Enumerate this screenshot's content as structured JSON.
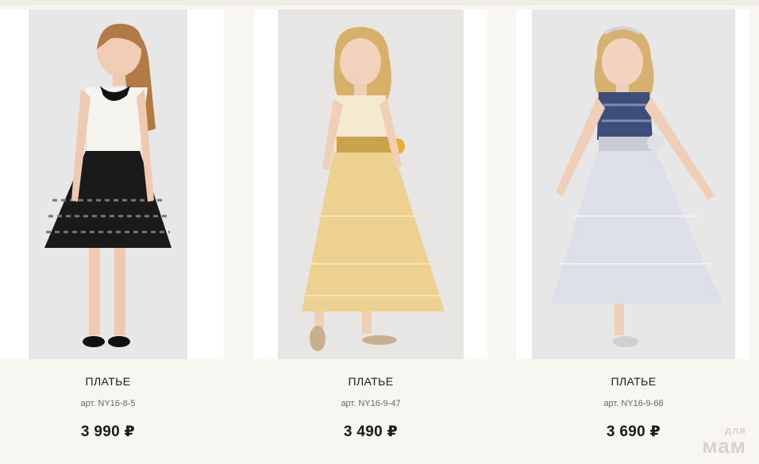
{
  "products": [
    {
      "title": "ПЛАТЬЕ",
      "sku": "арт. NY16-8-5",
      "price": "3 990 ₽"
    },
    {
      "title": "ПЛАТЬЕ",
      "sku": "арт. NY16-9-47",
      "price": "3 490 ₽"
    },
    {
      "title": "ПЛАТЬЕ",
      "sku": "арт. NY16-9-68",
      "price": "3 690 ₽"
    }
  ],
  "watermark": {
    "line1": "для",
    "line2": "мам"
  },
  "colors": {
    "background": "#f8f6f1",
    "card": "#ffffff",
    "photo_bg": "#e9e8e8",
    "text": "#1b1b1b",
    "muted": "#666666"
  }
}
